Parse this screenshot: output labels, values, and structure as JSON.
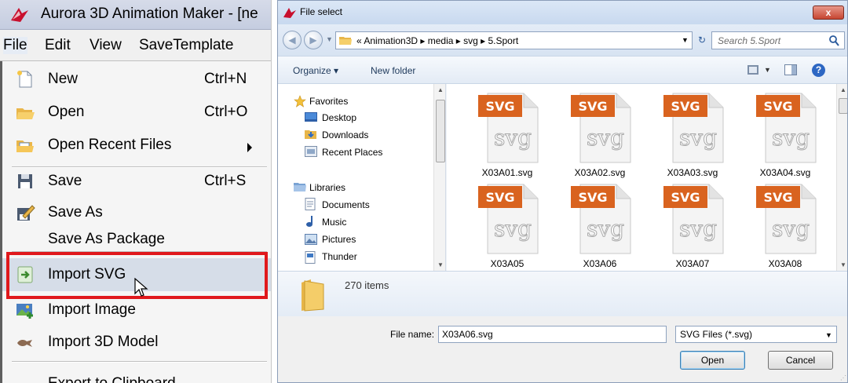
{
  "app": {
    "title": "Aurora 3D Animation Maker - [ne",
    "menubar": [
      "File",
      "Edit",
      "View",
      "SaveTemplate"
    ],
    "file_menu": {
      "new": {
        "label": "New",
        "shortcut": "Ctrl+N"
      },
      "open": {
        "label": "Open",
        "shortcut": "Ctrl+O"
      },
      "recent": {
        "label": "Open Recent Files"
      },
      "save": {
        "label": "Save",
        "shortcut": "Ctrl+S"
      },
      "save_as": {
        "label": "Save As"
      },
      "save_as_package": {
        "label": "Save As Package"
      },
      "import_svg": {
        "label": "Import SVG"
      },
      "import_image": {
        "label": "Import Image"
      },
      "import_3d": {
        "label": "Import 3D Model"
      },
      "export_clipboard": {
        "label": "Export to Clipboard"
      }
    },
    "highlight_color": "#e0181c"
  },
  "dialog": {
    "title": "File select",
    "close_label": "x",
    "breadcrumb": "«  Animation3D  ▸  media  ▸  svg  ▸  5.Sport",
    "search_placeholder": "Search 5.Sport",
    "toolbar": {
      "organize": "Organize ▾",
      "new_folder": "New folder"
    },
    "nav": {
      "favorites": "Favorites",
      "desktop": "Desktop",
      "downloads": "Downloads",
      "recent_places": "Recent Places",
      "libraries": "Libraries",
      "documents": "Documents",
      "music": "Music",
      "pictures": "Pictures",
      "thunder": "Thunder"
    },
    "files": [
      {
        "name": "X03A01.svg",
        "badge": "SVG",
        "watermark": "SVG"
      },
      {
        "name": "X03A02.svg",
        "badge": "SVG",
        "watermark": "SVG"
      },
      {
        "name": "X03A03.svg",
        "badge": "SVG",
        "watermark": "SVG"
      },
      {
        "name": "X03A04.svg",
        "badge": "SVG",
        "watermark": "SVG"
      },
      {
        "name": "X03A05",
        "badge": "SVG",
        "watermark": "SVG"
      },
      {
        "name": "X03A06",
        "badge": "SVG",
        "watermark": "SVG"
      },
      {
        "name": "X03A07",
        "badge": "SVG",
        "watermark": "SVG"
      },
      {
        "name": "X03A08",
        "badge": "SVG",
        "watermark": "SVG"
      }
    ],
    "item_count": "270 items",
    "file_name_label": "File name:",
    "file_name_value": "X03A06.svg",
    "filter_value": "SVG Files (*.svg)",
    "open_label": "Open",
    "cancel_label": "Cancel",
    "badge_color": "#d9631f"
  }
}
